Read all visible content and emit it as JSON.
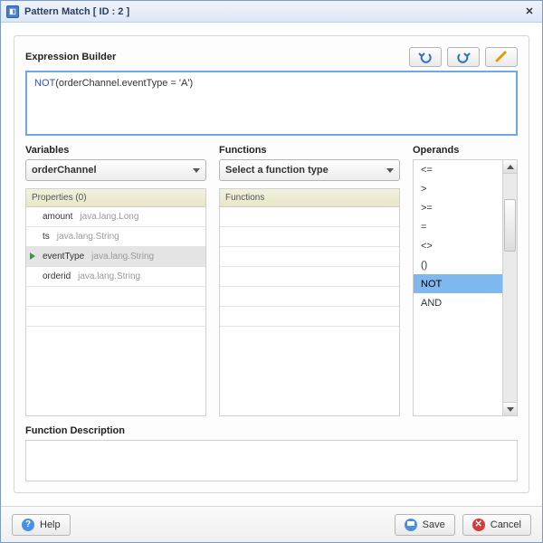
{
  "title": "Pattern Match [ ID : 2 ]",
  "expression_builder": {
    "label": "Expression Builder",
    "keyword": "NOT",
    "rest": "(orderChannel.eventType = 'A')"
  },
  "variables": {
    "label": "Variables",
    "selector": "orderChannel",
    "panel_head": "Properties (0)",
    "items": [
      {
        "name": "amount",
        "type": "java.lang.Long",
        "selected": false
      },
      {
        "name": "ts",
        "type": "java.lang.String",
        "selected": false
      },
      {
        "name": "eventType",
        "type": "java.lang.String",
        "selected": true
      },
      {
        "name": "orderid",
        "type": "java.lang.String",
        "selected": false
      }
    ]
  },
  "functions": {
    "label": "Functions",
    "selector": "Select a function type",
    "panel_head": "Functions"
  },
  "operands": {
    "label": "Operands",
    "items": [
      {
        "value": "<=",
        "selected": false
      },
      {
        "value": ">",
        "selected": false
      },
      {
        "value": ">=",
        "selected": false
      },
      {
        "value": "=",
        "selected": false
      },
      {
        "value": "<>",
        "selected": false
      },
      {
        "value": "()",
        "selected": false
      },
      {
        "value": "NOT",
        "selected": true
      },
      {
        "value": "AND",
        "selected": false
      }
    ]
  },
  "function_description": {
    "label": "Function Description"
  },
  "footer": {
    "help": "Help",
    "save": "Save",
    "cancel": "Cancel"
  }
}
